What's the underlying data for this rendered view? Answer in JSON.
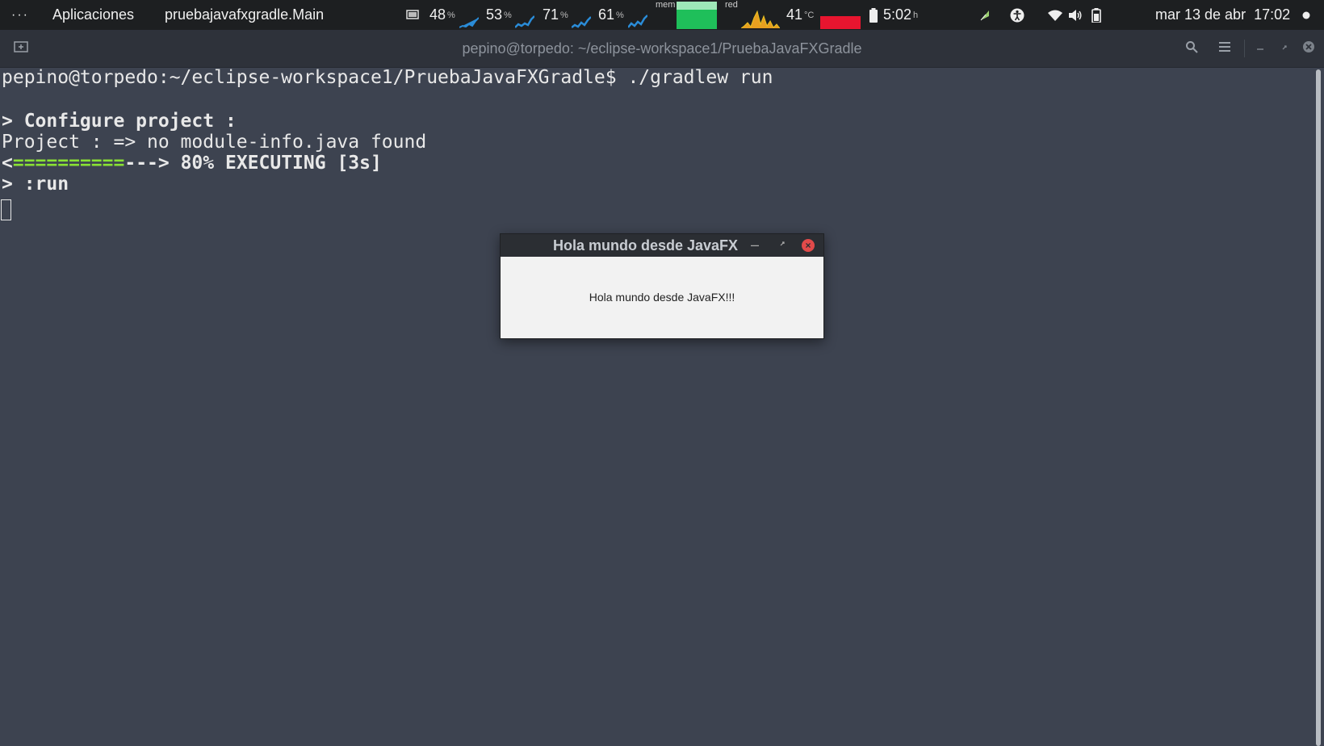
{
  "topbar": {
    "activities": "···",
    "apps_label": "Aplicaciones",
    "window_name": "pruebajavafxgradle.Main",
    "cpu": [
      {
        "value": "48",
        "unit": "%"
      },
      {
        "value": "53",
        "unit": "%"
      },
      {
        "value": "71",
        "unit": "%"
      },
      {
        "value": "61",
        "unit": "%"
      }
    ],
    "mem_label": "mem",
    "net_label": "red",
    "temp_value": "41",
    "temp_unit": "°C",
    "battery_time": "5:02",
    "battery_unit": "h",
    "datetime": "mar 13 de abr  17:02",
    "colors": {
      "cpu_graph": "#2a8cd8",
      "mem_graph": "#1fbf5a",
      "net_graph": "#e8c020",
      "temp_bar": "#e8152f"
    }
  },
  "terminal": {
    "title": "pepino@torpedo: ~/eclipse-workspace1/PruebaJavaFXGradle",
    "lines": {
      "prompt": "pepino@torpedo:~/eclipse-workspace1/PruebaJavaFXGradle$ ./gradlew run",
      "configure": "> Configure project :",
      "project": "Project : => no module-info.java found",
      "progress_open": "<",
      "progress_bar": "==========",
      "progress_rest": "---> 80% EXECUTING [3s]",
      "run": "> :run"
    }
  },
  "dialog": {
    "title": "Hola mundo desde JavaFX",
    "message": "Hola mundo desde JavaFX!!!"
  }
}
